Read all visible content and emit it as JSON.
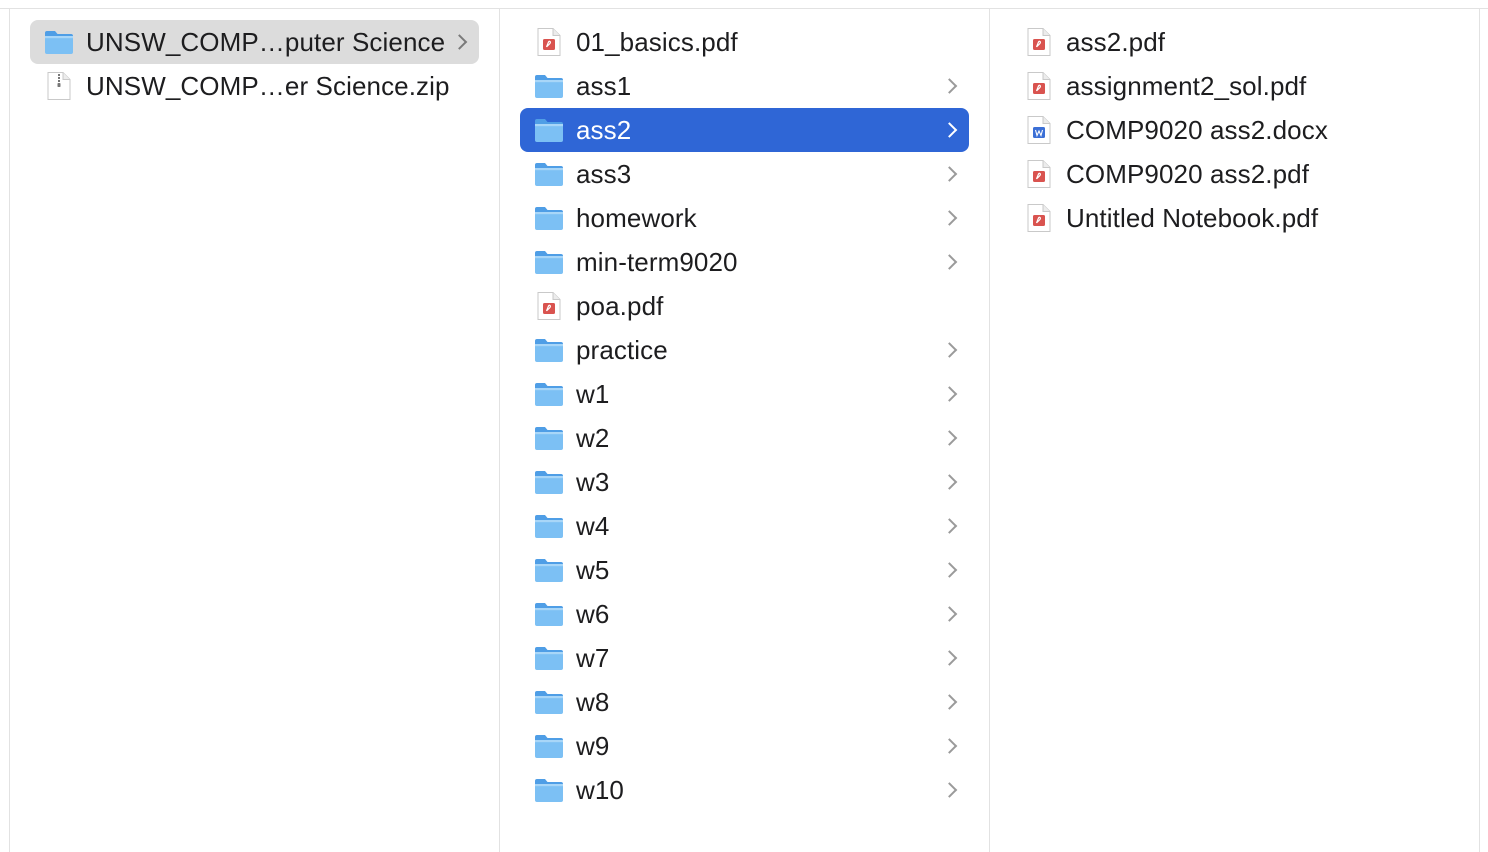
{
  "columns": [
    {
      "items": [
        {
          "label": "UNSW_COMP…puter Science",
          "kind": "folder",
          "chevron": true,
          "state": "selected-inactive"
        },
        {
          "label": "UNSW_COMP…er Science.zip",
          "kind": "zip",
          "chevron": false,
          "state": "normal"
        }
      ]
    },
    {
      "items": [
        {
          "label": "01_basics.pdf",
          "kind": "pdf",
          "chevron": false,
          "state": "normal"
        },
        {
          "label": "ass1",
          "kind": "folder",
          "chevron": true,
          "state": "normal"
        },
        {
          "label": "ass2",
          "kind": "folder",
          "chevron": true,
          "state": "selected-active"
        },
        {
          "label": "ass3",
          "kind": "folder",
          "chevron": true,
          "state": "normal"
        },
        {
          "label": "homework",
          "kind": "folder",
          "chevron": true,
          "state": "normal"
        },
        {
          "label": "min-term9020",
          "kind": "folder",
          "chevron": true,
          "state": "normal"
        },
        {
          "label": "poa.pdf",
          "kind": "pdf",
          "chevron": false,
          "state": "normal"
        },
        {
          "label": "practice",
          "kind": "folder",
          "chevron": true,
          "state": "normal"
        },
        {
          "label": "w1",
          "kind": "folder",
          "chevron": true,
          "state": "normal"
        },
        {
          "label": "w2",
          "kind": "folder",
          "chevron": true,
          "state": "normal"
        },
        {
          "label": "w3",
          "kind": "folder",
          "chevron": true,
          "state": "normal"
        },
        {
          "label": "w4",
          "kind": "folder",
          "chevron": true,
          "state": "normal"
        },
        {
          "label": "w5",
          "kind": "folder",
          "chevron": true,
          "state": "normal"
        },
        {
          "label": "w6",
          "kind": "folder",
          "chevron": true,
          "state": "normal"
        },
        {
          "label": "w7",
          "kind": "folder",
          "chevron": true,
          "state": "normal"
        },
        {
          "label": "w8",
          "kind": "folder",
          "chevron": true,
          "state": "normal"
        },
        {
          "label": "w9",
          "kind": "folder",
          "chevron": true,
          "state": "normal"
        },
        {
          "label": "w10",
          "kind": "folder",
          "chevron": true,
          "state": "normal"
        }
      ]
    },
    {
      "items": [
        {
          "label": "ass2.pdf",
          "kind": "pdf",
          "chevron": false,
          "state": "normal"
        },
        {
          "label": "assignment2_sol.pdf",
          "kind": "pdf",
          "chevron": false,
          "state": "normal"
        },
        {
          "label": "COMP9020 ass2.docx",
          "kind": "docx",
          "chevron": false,
          "state": "normal"
        },
        {
          "label": "COMP9020 ass2.pdf",
          "kind": "pdf",
          "chevron": false,
          "state": "normal"
        },
        {
          "label": "Untitled Notebook.pdf",
          "kind": "pdf",
          "chevron": false,
          "state": "normal"
        }
      ]
    }
  ],
  "colors": {
    "selection_active": "#2f66d6",
    "selection_inactive": "#dcdcdc",
    "folder": "#6cb4f0",
    "pdf_badge": "#d9534f",
    "docx_badge": "#3b6fd6"
  }
}
